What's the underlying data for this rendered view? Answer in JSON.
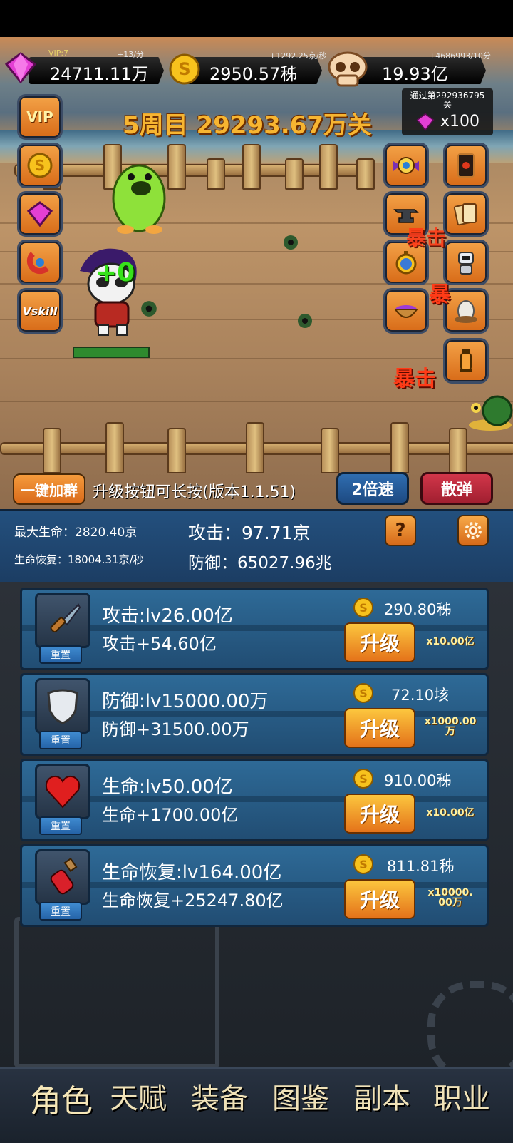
{
  "resources": {
    "vip": "VIP:7",
    "gem_rate": "+13/分",
    "gem_value": "24711.11万",
    "coin_rate": "+1292.25京/秒",
    "coin_value": "2950.57秭",
    "skull_rate": "+4686993/10分",
    "skull_value": "19.93亿"
  },
  "stage": {
    "title": "5周目 29293.67万关",
    "pass_line1": "通过第292936795",
    "pass_line2": "关",
    "pass_reward": "x100"
  },
  "battle": {
    "damage_popup": "+0",
    "crit_text_1": "暴击",
    "crit_text_2": "暴",
    "crit_text_3": "暴击"
  },
  "left_buttons": [
    "VIP",
    "coin-icon",
    "gem-icon",
    "magnet-icon",
    "Vskill"
  ],
  "scene_bar": {
    "join_group": "一键加群",
    "hint": "升级按钮可长按(版本1.1.51)",
    "speed": "2倍速",
    "scatter": "散弹"
  },
  "stats": {
    "max_hp": "最大生命：2820.40京",
    "regen": "生命恢复：18004.31京/秒",
    "attack": "攻击：97.71京",
    "defense": "防御：65027.96兆",
    "help": "?"
  },
  "upgrades": [
    {
      "name": "攻击:lv26.00亿",
      "bonus": "攻击+54.60亿",
      "cost": "290.80秭",
      "button": "升级",
      "mult1": "x10.00亿",
      "mult2": "",
      "reset": "重置"
    },
    {
      "name": "防御:lv15000.00万",
      "bonus": "防御+31500.00万",
      "cost": "72.10垓",
      "button": "升级",
      "mult1": "x1000.00",
      "mult2": "万",
      "reset": "重置"
    },
    {
      "name": "生命:lv50.00亿",
      "bonus": "生命+1700.00亿",
      "cost": "910.00秭",
      "button": "升级",
      "mult1": "x10.00亿",
      "mult2": "",
      "reset": "重置"
    },
    {
      "name": "生命恢复:lv164.00亿",
      "bonus": "生命恢复+25247.80亿",
      "cost": "811.81秭",
      "button": "升级",
      "mult1": "x10000.",
      "mult2": "00万",
      "reset": "重置"
    }
  ],
  "nav": [
    "角色",
    "天赋",
    "装备",
    "图鉴",
    "副本",
    "职业"
  ],
  "colors": {
    "accent": "#f7b531",
    "panel": "#23507e",
    "button": "#e4731a",
    "crit": "#ff3b17"
  }
}
